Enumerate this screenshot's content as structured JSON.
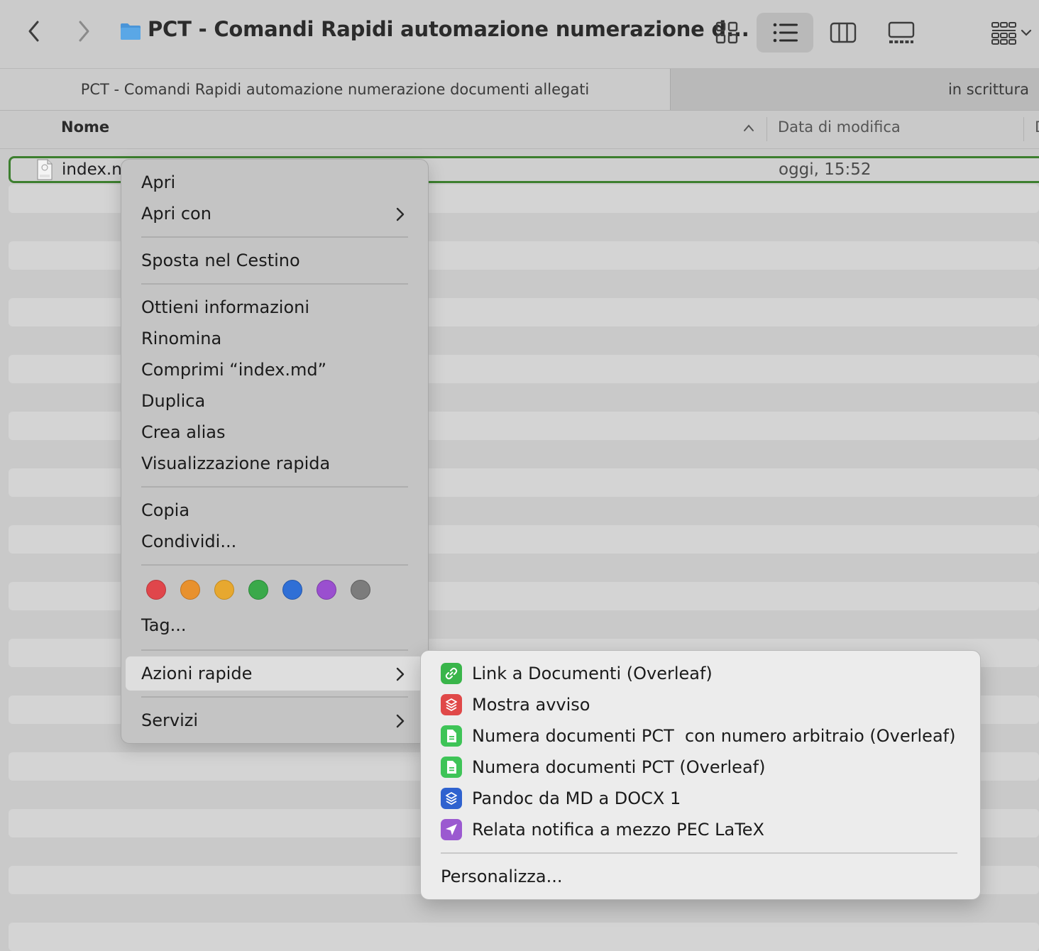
{
  "toolbar": {
    "title": "PCT - Comandi Rapidi automazione numerazione d...",
    "view_buttons": [
      "icon-view-icon",
      "list-view-icon",
      "column-view-icon",
      "gallery-view-icon",
      "group-icon"
    ]
  },
  "tabs": [
    {
      "label": "PCT - Comandi Rapidi automazione numerazione documenti allegati",
      "active": true
    },
    {
      "label": "in scrittura",
      "active": false
    }
  ],
  "columns": {
    "name": "Nome",
    "date": "Data di modifica",
    "more": "D"
  },
  "file": {
    "name": "index.md",
    "name_visible": "index.n",
    "modified": "oggi, 15:52"
  },
  "context_menu": {
    "open": "Apri",
    "open_with": "Apri con",
    "trash": "Sposta nel Cestino",
    "get_info": "Ottieni informazioni",
    "rename": "Rinomina",
    "compress": "Comprimi “index.md”",
    "duplicate": "Duplica",
    "make_alias": "Crea alias",
    "quick_look": "Visualizzazione rapida",
    "copy": "Copia",
    "share": "Condividi...",
    "tags": "Tag...",
    "quick_actions": "Azioni rapide",
    "services": "Servizi",
    "tag_colors": [
      "#e0464b",
      "#e8912e",
      "#e7a82f",
      "#3aa94a",
      "#2f6fd6",
      "#9a4fcf",
      "#7c7c7c"
    ]
  },
  "quick_actions_menu": {
    "items": [
      {
        "label": "Link a Documenti (Overleaf)",
        "icon": "link-icon",
        "color": "#39b54a"
      },
      {
        "label": "Mostra avviso",
        "icon": "shortcuts-icon",
        "color": "#e04848"
      },
      {
        "label": "Numera documenti PCT  con numero arbitraio (Overleaf)",
        "icon": "document-icon",
        "color": "#3ec457"
      },
      {
        "label": "Numera documenti PCT (Overleaf)",
        "icon": "document-icon",
        "color": "#3ec457"
      },
      {
        "label": "Pandoc da MD a DOCX 1",
        "icon": "shortcuts-icon",
        "color": "#2f62cf"
      },
      {
        "label": "Relata notifica a mezzo PEC LaTeX",
        "icon": "send-icon",
        "color": "#9b59d0"
      }
    ],
    "customize": "Personalizza..."
  }
}
